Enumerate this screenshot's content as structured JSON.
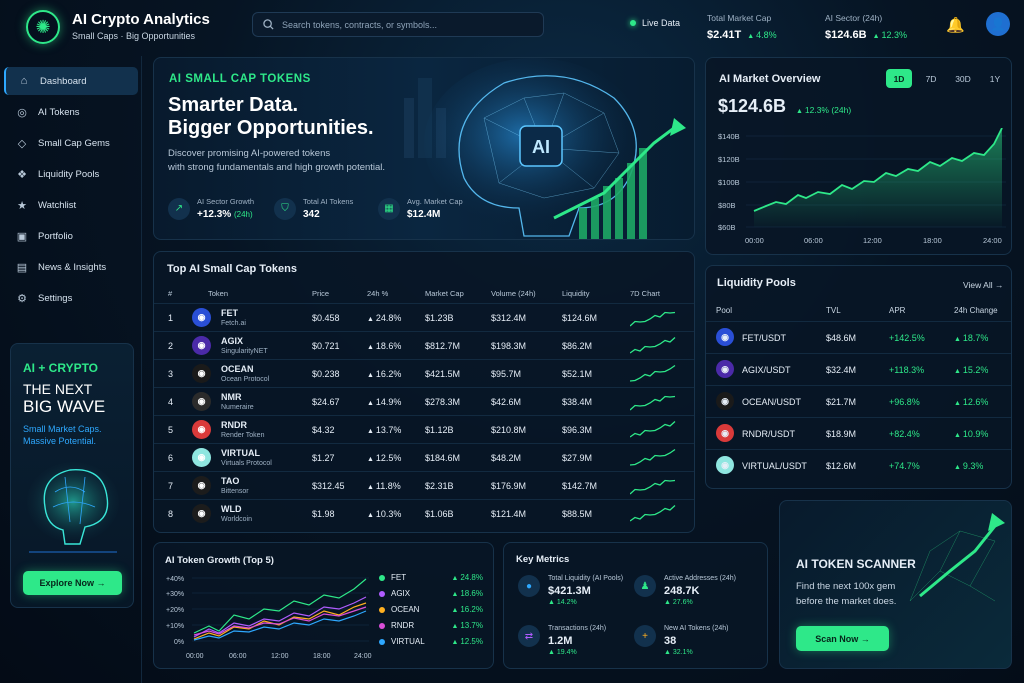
{
  "brand": {
    "title": "AI Crypto Analytics",
    "subtitle": "Small Caps · Big Opportunities"
  },
  "search": {
    "placeholder": "Search tokens, contracts, or symbols..."
  },
  "live": "Live Data",
  "header_stats": [
    {
      "label": "Total Market Cap",
      "value": "$2.41T",
      "change": "4.8%"
    },
    {
      "label": "AI Sector (24h)",
      "value": "$124.6B",
      "change": "12.3%"
    }
  ],
  "nav": [
    {
      "label": "Dashboard",
      "icon": "home-icon"
    },
    {
      "label": "AI Tokens",
      "icon": "token-icon"
    },
    {
      "label": "Small Cap Gems",
      "icon": "gem-icon"
    },
    {
      "label": "Liquidity Pools",
      "icon": "pool-icon"
    },
    {
      "label": "Watchlist",
      "icon": "star-icon"
    },
    {
      "label": "Portfolio",
      "icon": "briefcase-icon"
    },
    {
      "label": "News & Insights",
      "icon": "news-icon"
    },
    {
      "label": "Settings",
      "icon": "gear-icon"
    }
  ],
  "promo": {
    "line1": "AI + CRYPTO",
    "line2": "THE NEXT",
    "line3": "BIG WAVE",
    "desc": "Small Market Caps. Massive Potential.",
    "button": "Explore Now →"
  },
  "hero": {
    "tag": "AI SMALL CAP TOKENS",
    "title1": "Smarter Data.",
    "title2": "Bigger Opportunities.",
    "desc1": "Discover promising AI-powered tokens",
    "desc2": "with strong fundamentals and high growth potential.",
    "chip": "AI",
    "stats": [
      {
        "label": "AI Sector Growth",
        "value": "+12.3%",
        "extra": "(24h)"
      },
      {
        "label": "Total AI Tokens",
        "value": "342",
        "extra": ""
      },
      {
        "label": "Avg. Market Cap",
        "value": "$12.4M",
        "extra": ""
      }
    ]
  },
  "table": {
    "title": "Top AI Small Cap Tokens",
    "headers": [
      "#",
      "Token",
      "Price",
      "24h %",
      "Market Cap",
      "Volume (24h)",
      "Liquidity",
      "7D Chart"
    ],
    "rows": [
      {
        "n": "1",
        "sym": "FET",
        "name": "Fetch.ai",
        "price": "$0.458",
        "chg": "24.8%",
        "mcap": "$1.23B",
        "vol": "$312.4M",
        "liq": "$124.6M",
        "color": "#2a4fd6"
      },
      {
        "n": "2",
        "sym": "AGIX",
        "name": "SingularityNET",
        "price": "$0.721",
        "chg": "18.6%",
        "mcap": "$812.7M",
        "vol": "$198.3M",
        "liq": "$86.2M",
        "color": "#4b2aa8"
      },
      {
        "n": "3",
        "sym": "OCEAN",
        "name": "Ocean Protocol",
        "price": "$0.238",
        "chg": "16.2%",
        "mcap": "$421.5M",
        "vol": "$95.7M",
        "liq": "$52.1M",
        "color": "#1a1a1a"
      },
      {
        "n": "4",
        "sym": "NMR",
        "name": "Numeraire",
        "price": "$24.67",
        "chg": "14.9%",
        "mcap": "$278.3M",
        "vol": "$42.6M",
        "liq": "$38.4M",
        "color": "#2b2b2b"
      },
      {
        "n": "5",
        "sym": "RNDR",
        "name": "Render Token",
        "price": "$4.32",
        "chg": "13.7%",
        "mcap": "$1.12B",
        "vol": "$210.8M",
        "liq": "$96.3M",
        "color": "#d93a3a"
      },
      {
        "n": "6",
        "sym": "VIRTUAL",
        "name": "Virtuals Protocol",
        "price": "$1.27",
        "chg": "12.5%",
        "mcap": "$184.6M",
        "vol": "$48.2M",
        "liq": "$27.9M",
        "color": "#8fe6e0"
      },
      {
        "n": "7",
        "sym": "TAO",
        "name": "Bittensor",
        "price": "$312.45",
        "chg": "11.8%",
        "mcap": "$2.31B",
        "vol": "$176.9M",
        "liq": "$142.7M",
        "color": "#1c1c1c"
      },
      {
        "n": "8",
        "sym": "WLD",
        "name": "Worldcoin",
        "price": "$1.98",
        "chg": "10.3%",
        "mcap": "$1.06B",
        "vol": "$121.4M",
        "liq": "$88.5M",
        "color": "#1c1c1c"
      }
    ]
  },
  "market": {
    "title": "AI Market Overview",
    "value": "$124.6B",
    "change": "12.3% (24h)",
    "tabs": [
      "1D",
      "7D",
      "30D",
      "1Y"
    ],
    "yticks": [
      "$140B",
      "$120B",
      "$100B",
      "$80B",
      "$60B"
    ],
    "xticks": [
      "00:00",
      "06:00",
      "12:00",
      "18:00",
      "24:00"
    ]
  },
  "liquidity": {
    "title": "Liquidity Pools",
    "view_all": "View All →",
    "headers": [
      "Pool",
      "TVL",
      "APR",
      "24h Change"
    ],
    "rows": [
      {
        "pool": "FET/USDT",
        "tvl": "$48.6M",
        "apr": "+142.5%",
        "chg": "18.7%",
        "color": "#2a4fd6"
      },
      {
        "pool": "AGIX/USDT",
        "tvl": "$32.4M",
        "apr": "+118.3%",
        "chg": "15.2%",
        "color": "#4b2aa8"
      },
      {
        "pool": "OCEAN/USDT",
        "tvl": "$21.7M",
        "apr": "+96.8%",
        "chg": "12.6%",
        "color": "#1a1a1a"
      },
      {
        "pool": "RNDR/USDT",
        "tvl": "$18.9M",
        "apr": "+82.4%",
        "chg": "10.9%",
        "color": "#d93a3a"
      },
      {
        "pool": "VIRTUAL/USDT",
        "tvl": "$12.6M",
        "apr": "+74.7%",
        "chg": "9.3%",
        "color": "#8fe6e0"
      }
    ]
  },
  "growth": {
    "title": "AI Token Growth (Top 5)",
    "yticks": [
      "+40%",
      "+30%",
      "+20%",
      "+10%",
      "0%"
    ],
    "xticks": [
      "00:00",
      "06:00",
      "12:00",
      "18:00",
      "24:00"
    ],
    "legend": [
      {
        "name": "FET",
        "value": "24.8%",
        "color": "#2ee889"
      },
      {
        "name": "AGIX",
        "value": "18.6%",
        "color": "#b05cff"
      },
      {
        "name": "OCEAN",
        "value": "16.2%",
        "color": "#ffb020"
      },
      {
        "name": "RNDR",
        "value": "13.7%",
        "color": "#d94fd9"
      },
      {
        "name": "VIRTUAL",
        "value": "12.5%",
        "color": "#2ea8ff"
      }
    ]
  },
  "metrics": {
    "title": "Key Metrics",
    "items": [
      {
        "label": "Total Liquidity (AI Pools)",
        "value": "$421.3M",
        "pct": "14.2%",
        "icon": "drop-icon"
      },
      {
        "label": "Active Addresses (24h)",
        "value": "248.7K",
        "pct": "27.6%",
        "icon": "user-icon"
      },
      {
        "label": "Transactions (24h)",
        "value": "1.2M",
        "pct": "19.4%",
        "icon": "swap-icon"
      },
      {
        "label": "New AI Tokens (24h)",
        "value": "38",
        "pct": "32.1%",
        "icon": "plus-icon"
      }
    ]
  },
  "scanner": {
    "title": "AI TOKEN SCANNER",
    "desc1": "Find the next 100x gem",
    "desc2": "before the market does.",
    "button": "Scan Now →"
  }
}
